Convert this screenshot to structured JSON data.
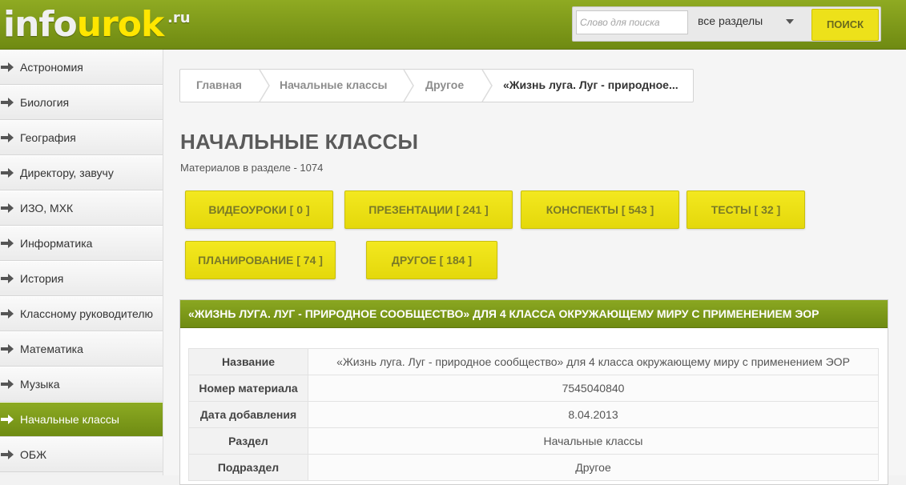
{
  "header": {
    "logo_text_1": "info",
    "logo_text_2": "urok",
    "logo_tld": ".ru",
    "search_placeholder": "Слово для поиска",
    "section_value": "все разделы",
    "search_button": "ПОИСК"
  },
  "sidebar": {
    "items": [
      {
        "label": "Астрономия"
      },
      {
        "label": "Биология"
      },
      {
        "label": "География"
      },
      {
        "label": "Директору, завучу"
      },
      {
        "label": "ИЗО, МХК"
      },
      {
        "label": "Информатика"
      },
      {
        "label": "История"
      },
      {
        "label": "Классному руководителю"
      },
      {
        "label": "Математика"
      },
      {
        "label": "Музыка"
      },
      {
        "label": "Начальные классы"
      },
      {
        "label": "ОБЖ"
      }
    ],
    "active_label": "Начальные классы"
  },
  "breadcrumb": [
    "Главная",
    "Начальные классы",
    "Другое",
    "«Жизнь луга. Луг - природное..."
  ],
  "page": {
    "title": "НАЧАЛЬНЫЕ КЛАССЫ",
    "count_text": "Материалов в разделе - 1074"
  },
  "categories": [
    "ВИДЕОУРОКИ [ 0 ]",
    "ПРЕЗЕНТАЦИИ [ 241 ]",
    "КОНСПЕКТЫ [ 543 ]",
    "ТЕСТЫ [ 32 ]",
    "ПЛАНИРОВАНИЕ [ 74 ]",
    "ДРУГОЕ [ 184 ]"
  ],
  "material": {
    "heading": "«ЖИЗНЬ ЛУГА. ЛУГ - ПРИРОДНОЕ СООБЩЕСТВО» ДЛЯ 4 КЛАССА ОКРУЖАЮЩЕМУ МИРУ С ПРИМЕНЕНИЕМ ЭОР",
    "rows": [
      {
        "key": "Название",
        "value": "«Жизнь луга. Луг - природное сообщество» для 4 класса окружающему миру с применением ЭОР"
      },
      {
        "key": "Номер материала",
        "value": "7545040840"
      },
      {
        "key": "Дата добавления",
        "value": "8.04.2013"
      },
      {
        "key": "Раздел",
        "value": "Начальные классы"
      },
      {
        "key": "Подраздел",
        "value": "Другое"
      }
    ]
  },
  "colors": {
    "brand_green": "#7d9a1a",
    "accent_yellow": "#ede11a"
  }
}
